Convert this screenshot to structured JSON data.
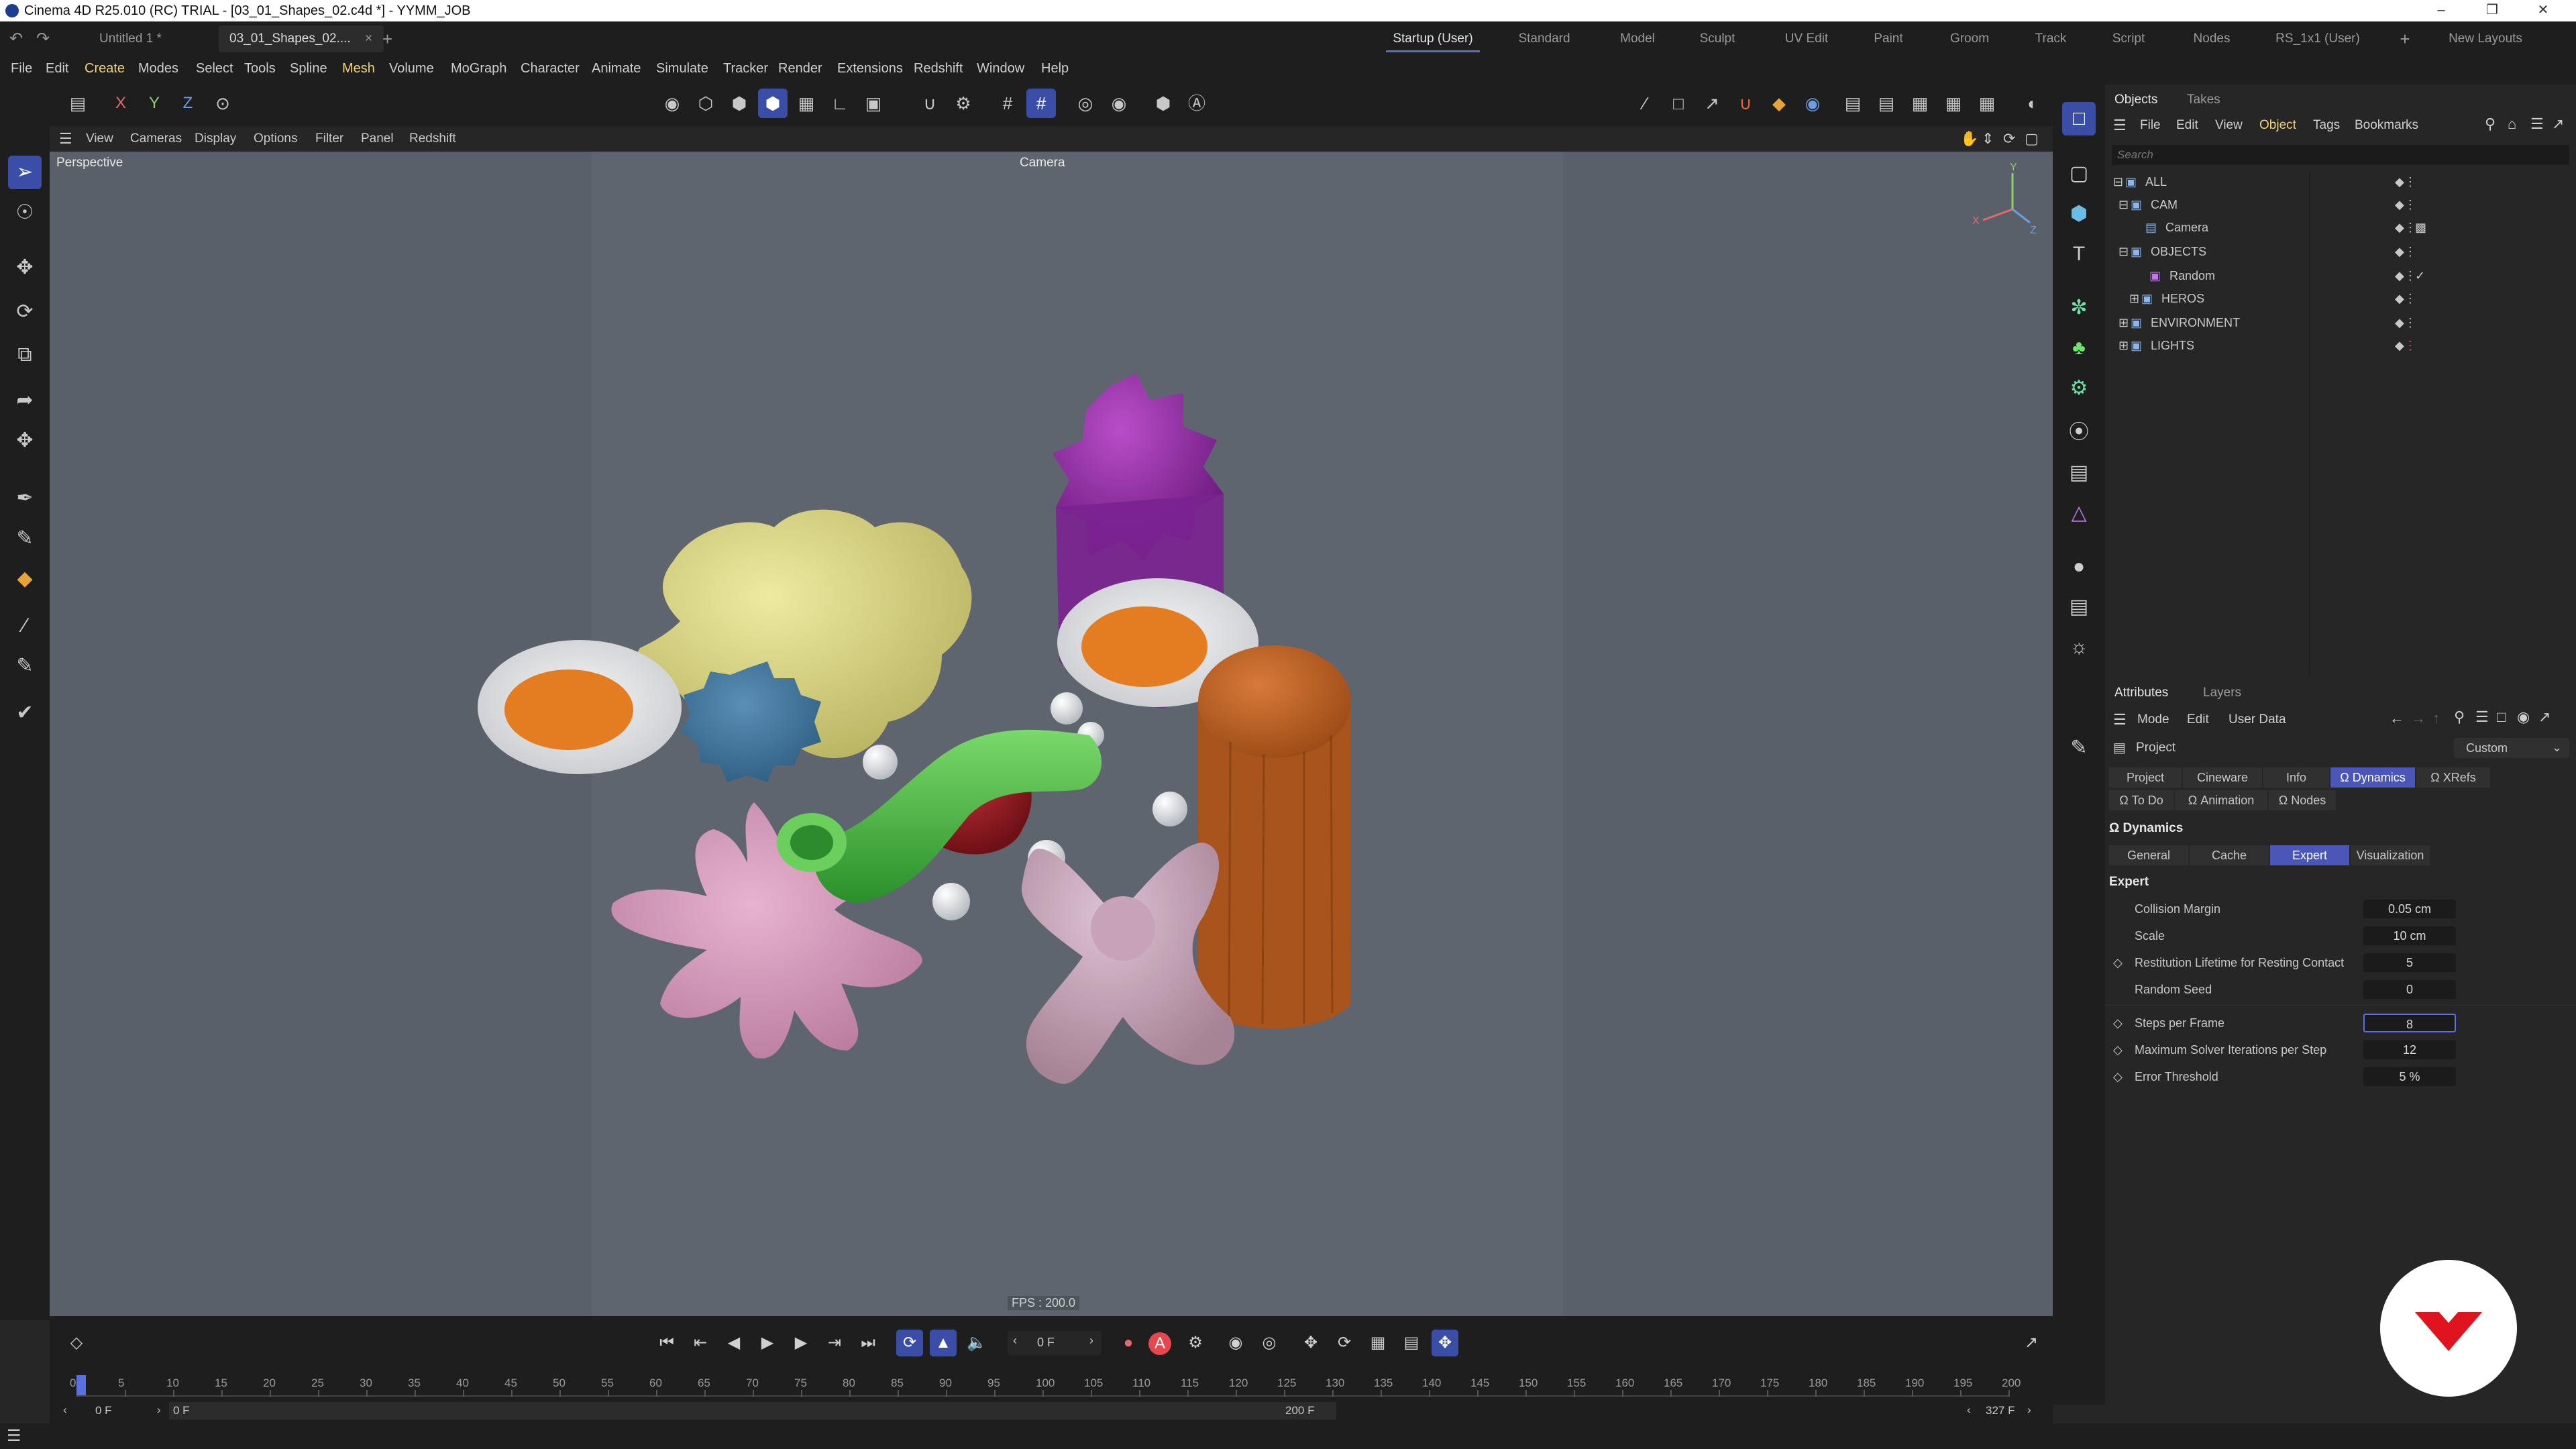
{
  "titlebar": {
    "title": "Cinema 4D R25.010 (RC) TRIAL - [03_01_Shapes_02.c4d *] - YYMM_JOB"
  },
  "doc_tabs": [
    "Untitled 1 *",
    "03_01_Shapes_02...."
  ],
  "layouts": [
    "Startup (User)",
    "Standard",
    "Model",
    "Sculpt",
    "UV Edit",
    "Paint",
    "Groom",
    "Track",
    "Script",
    "Nodes",
    "RS_1x1 (User)"
  ],
  "new_layouts": "New Layouts",
  "menus": [
    "File",
    "Edit",
    "Create",
    "Modes",
    "Select",
    "Tools",
    "Spline",
    "Mesh",
    "Volume",
    "MoGraph",
    "Character",
    "Animate",
    "Simulate",
    "Tracker",
    "Render",
    "Extensions",
    "Redshift",
    "Window",
    "Help"
  ],
  "axis_toggles": [
    "X",
    "Y",
    "Z"
  ],
  "viewport_menu": [
    "View",
    "Cameras",
    "Display",
    "Options",
    "Filter",
    "Panel",
    "Redshift"
  ],
  "viewport": {
    "label": "Perspective",
    "camera": "Camera",
    "fps": "FPS : 200.0",
    "axis": {
      "y": "Y",
      "x": "X",
      "z": "Z"
    },
    "colors": {
      "background": "#596069",
      "safe_frame": "#5e656f"
    }
  },
  "objects_panel": {
    "tabs": [
      "Objects",
      "Takes"
    ],
    "menu": [
      "File",
      "Edit",
      "View",
      "Object",
      "Tags",
      "Bookmarks"
    ],
    "search_placeholder": "Search",
    "tree": [
      {
        "label": "ALL",
        "type": "layer",
        "expanded": true
      },
      {
        "label": "CAM",
        "type": "null",
        "expanded": true
      },
      {
        "label": "Camera",
        "type": "camera"
      },
      {
        "label": "OBJECTS",
        "type": "null",
        "expanded": true
      },
      {
        "label": "Random",
        "type": "effector"
      },
      {
        "label": "HEROS",
        "type": "null",
        "expanded": false
      },
      {
        "label": "ENVIRONMENT",
        "type": "null",
        "expanded": false
      },
      {
        "label": "LIGHTS",
        "type": "null",
        "expanded": false
      }
    ]
  },
  "attributes_panel": {
    "tabs": [
      "Attributes",
      "Layers"
    ],
    "menu": [
      "Mode",
      "Edit",
      "User Data"
    ],
    "object": "Project",
    "preset": "Custom",
    "project_tabs": [
      "Project",
      "Cineware",
      "Info",
      "Dynamics",
      "XRefs",
      "To Do",
      "Animation",
      "Nodes"
    ],
    "section": "Dynamics",
    "sub_tabs": [
      "General",
      "Cache",
      "Expert",
      "Visualization"
    ],
    "group": "Expert",
    "params": [
      {
        "label": "Collision Margin",
        "value": "0.05 cm"
      },
      {
        "label": "Scale",
        "value": "10 cm"
      },
      {
        "label": "Restitution Lifetime for Resting Contact",
        "value": "5"
      },
      {
        "label": "Random Seed",
        "value": "0"
      },
      {
        "label": "Steps per Frame",
        "value": "8"
      },
      {
        "label": "Maximum Solver Iterations per Step",
        "value": "12"
      },
      {
        "label": "Error Threshold",
        "value": "5 %"
      }
    ]
  },
  "timeline": {
    "current_frame": "0 F",
    "start": "0 F",
    "preview_start": "0 F",
    "preview_end": "200 F",
    "end": "327 F",
    "ticks": [
      "0",
      "5",
      "10",
      "15",
      "20",
      "25",
      "30",
      "35",
      "40",
      "45",
      "50",
      "55",
      "60",
      "65",
      "70",
      "75",
      "80",
      "85",
      "90",
      "95",
      "100",
      "105",
      "110",
      "115",
      "120",
      "125",
      "130",
      "135",
      "140",
      "145",
      "150",
      "155",
      "160",
      "165",
      "170",
      "175",
      "180",
      "185",
      "190",
      "195",
      "200"
    ]
  },
  "colors": {
    "accent": "#4a57b8",
    "ui_dark": "#1e1e1e",
    "panel": "#262626",
    "brand_red": "#e0141e"
  }
}
